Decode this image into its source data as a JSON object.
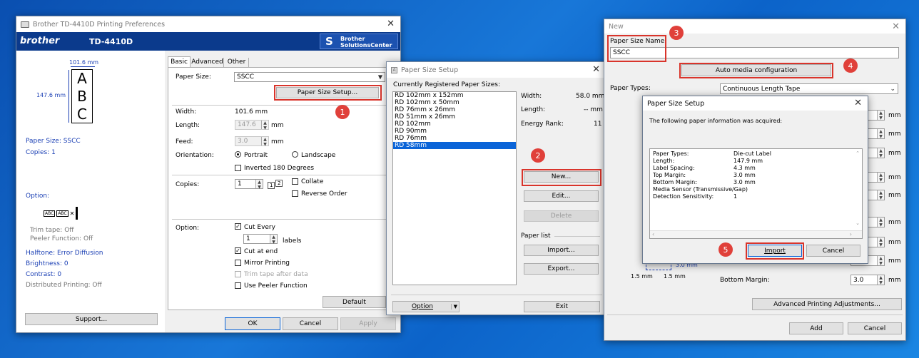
{
  "prefs": {
    "title": "Brother TD-4410D Printing Preferences",
    "brand": "brother",
    "model": "TD-4410D",
    "center_line1": "Brother",
    "center_line2": "SolutionsCenter",
    "preview_width": "101.6 mm",
    "preview_height": "147.6 mm",
    "preview_letters": [
      "A",
      "B",
      "C"
    ],
    "summary": {
      "paper_size": "Paper Size: SSCC",
      "copies": "Copies: 1",
      "option": "Option:",
      "trim": "Trim tape: Off",
      "peeler": "Peeler Function: Off",
      "halftone": "Halftone: Error Diffusion",
      "brightness": "Brightness:   0",
      "contrast": "Contrast:   0",
      "distributed": "Distributed Printing: Off"
    },
    "option_labels": [
      "ABC",
      "ABC"
    ],
    "support_button": "Support...",
    "tabs": [
      "Basic",
      "Advanced",
      "Other"
    ],
    "paper_size_label": "Paper Size:",
    "paper_size_value": "SSCC",
    "paper_size_setup_button": "Paper Size Setup...",
    "width_label": "Width:",
    "width_value": "101.6 mm",
    "length_label": "Length:",
    "length_value": "147.6",
    "mm": "mm",
    "feed_label": "Feed:",
    "feed_value": "3.0",
    "orientation_label": "Orientation:",
    "portrait": "Portrait",
    "landscape": "Landscape",
    "inverted": "Inverted 180 Degrees",
    "copies_label": "Copies:",
    "copies_value": "1",
    "collate": "Collate",
    "reverse": "Reverse Order",
    "option_label": "Option:",
    "cut_every": "Cut Every",
    "cut_every_value": "1",
    "labels": "labels",
    "cut_at_end": "Cut at end",
    "mirror": "Mirror Printing",
    "trim_after": "Trim tape after data",
    "peeler_fn": "Use Peeler Function",
    "default_button": "Default",
    "ok_button": "OK",
    "cancel_button": "Cancel",
    "apply_button": "Apply"
  },
  "setup": {
    "title": "Paper Size Setup",
    "registered_label": "Currently Registered Paper Sizes:",
    "sizes": [
      "RD 102mm x 152mm",
      "RD 102mm x 50mm",
      "RD 76mm x 26mm",
      "RD 51mm x 26mm",
      "RD 102mm",
      "RD 90mm",
      "RD 76mm",
      "RD 58mm"
    ],
    "width_label": "Width:",
    "width_value": "58.0 mm",
    "length_label": "Length:",
    "length_value": "-- mm",
    "energy_label": "Energy Rank:",
    "energy_value": "11",
    "new_button": "New...",
    "edit_button": "Edit...",
    "delete_button": "Delete",
    "paper_list_label": "Paper list",
    "import_button": "Import...",
    "export_button": "Export...",
    "option_button": "Option",
    "exit_button": "Exit"
  },
  "newwin": {
    "title": "New",
    "name_label": "Paper Size Name:",
    "name_value": "SSCC",
    "auto_button": "Auto media configuration",
    "types_label": "Paper Types:",
    "types_value": "Continuous Length Tape",
    "mm": "mm",
    "diag_dim1": "1.5 mm",
    "diag_dim2": "1.5 mm",
    "diag_dim3": "3.0 mm",
    "bottom_margin_label": "Bottom Margin:",
    "bottom_margin_value": "3.0",
    "advanced_button": "Advanced Printing Adjustments...",
    "add_button": "Add",
    "cancel_button": "Cancel"
  },
  "info": {
    "title": "Paper Size Setup",
    "message": "The following paper information was acquired:",
    "rows": [
      {
        "k": "Paper Types:",
        "v": "Die-cut Label"
      },
      {
        "k": "Length:",
        "v": "147.9 mm"
      },
      {
        "k": "Label Spacing:",
        "v": "4.3 mm"
      },
      {
        "k": "Top Margin:",
        "v": "3.0 mm"
      },
      {
        "k": "Bottom Margin:",
        "v": "3.0 mm"
      },
      {
        "k": "Media Sensor (Transmissive/Gap)",
        "v": ""
      },
      {
        "k": "Detection Sensitivity:",
        "v": "1"
      }
    ],
    "import_button": "Import",
    "cancel_button": "Cancel"
  },
  "badges": [
    "1",
    "2",
    "3",
    "4",
    "5"
  ],
  "colors": {
    "accent": "#d9342b",
    "brand": "#0b3a8c",
    "selection": "#0a64d8"
  }
}
